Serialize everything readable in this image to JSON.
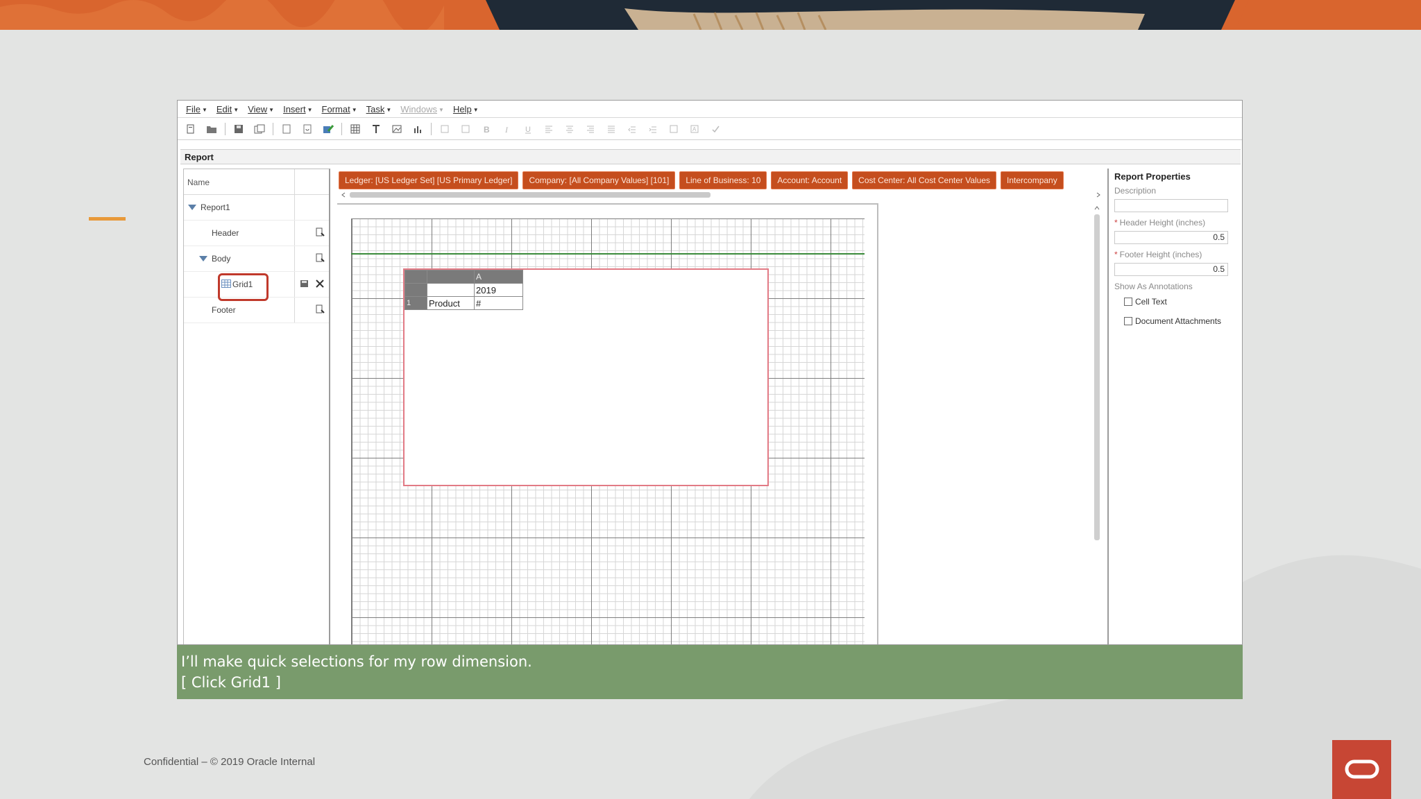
{
  "menu": [
    {
      "label": "File",
      "disabled": false
    },
    {
      "label": "Edit",
      "disabled": false
    },
    {
      "label": "View",
      "disabled": false
    },
    {
      "label": "Insert",
      "disabled": false
    },
    {
      "label": "Format",
      "disabled": false
    },
    {
      "label": "Task",
      "disabled": false
    },
    {
      "label": "Windows",
      "disabled": true
    },
    {
      "label": "Help",
      "disabled": false
    }
  ],
  "report_title": "Report",
  "tree": {
    "header": "Name",
    "items": [
      {
        "label": "Report1"
      },
      {
        "label": "Header"
      },
      {
        "label": "Body"
      },
      {
        "label": "Grid1"
      },
      {
        "label": "Footer"
      }
    ]
  },
  "pov_buttons": [
    "Ledger: [US Ledger Set] [US Primary Ledger]",
    "Company: [All Company Values] [101]",
    "Line of Business: 10",
    "Account: Account",
    "Cost Center: All Cost Center Values",
    "Intercompany"
  ],
  "grid": {
    "col_header": "A",
    "year": "2019",
    "row_number": "1",
    "row_label": "Product",
    "cell_value": "#"
  },
  "properties": {
    "title": "Report Properties",
    "description_label": "Description",
    "description_value": "",
    "header_height_label": "Header Height (inches)",
    "header_height_value": "0.5",
    "footer_height_label": "Footer Height (inches)",
    "footer_height_value": "0.5",
    "annotations_label": "Show As Annotations",
    "cell_text_label": "Cell Text",
    "doc_attachments_label": "Document Attachments"
  },
  "caption": {
    "line1": "I’ll make quick selections for my row dimension.",
    "line2": "[ Click Grid1 ]"
  },
  "footer_text": "Confidential – © 2019 Oracle Internal",
  "colors": {
    "pov_orange": "#c54e1e",
    "caption_green": "#799b6c",
    "brand_red": "#c74634",
    "highlight_red": "#c0392b",
    "accent_orange": "#e8993a"
  }
}
